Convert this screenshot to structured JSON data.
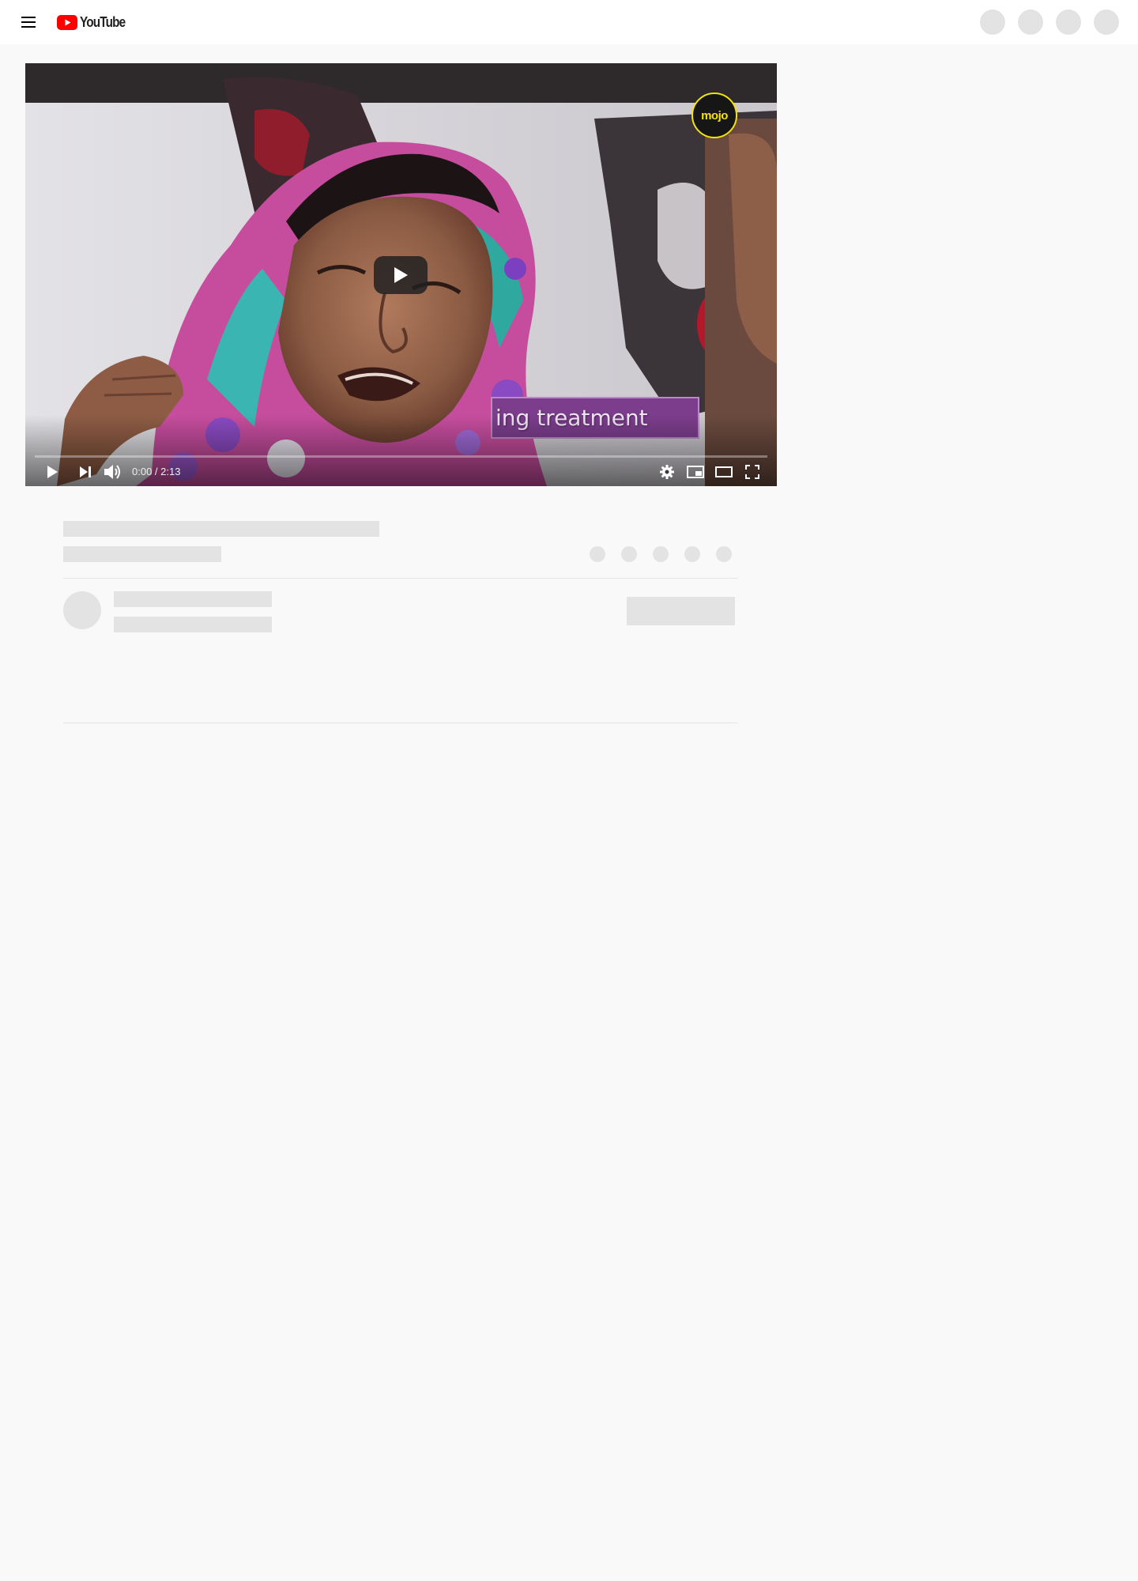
{
  "app": {
    "name": "YouTube"
  },
  "masthead": {
    "logo_text": "YouTube",
    "brand_color": "#ff0000",
    "icons": [
      "menu-icon",
      "youtube-logo-icon"
    ]
  },
  "player": {
    "logo_badge": "mojo",
    "lower_third_text": "ing treatment",
    "time_display": "0:00 / 2:13",
    "progress": 0,
    "accent_color": "#7b3d8c",
    "icons": [
      "play-icon",
      "next-icon",
      "volume-icon",
      "settings-icon",
      "miniplayer-icon",
      "theater-mode-icon",
      "fullscreen-icon"
    ]
  },
  "colors": {
    "page_background": "#f9f9f9",
    "skeleton": "#e3e3e3",
    "masthead_background": "#ffffff"
  }
}
